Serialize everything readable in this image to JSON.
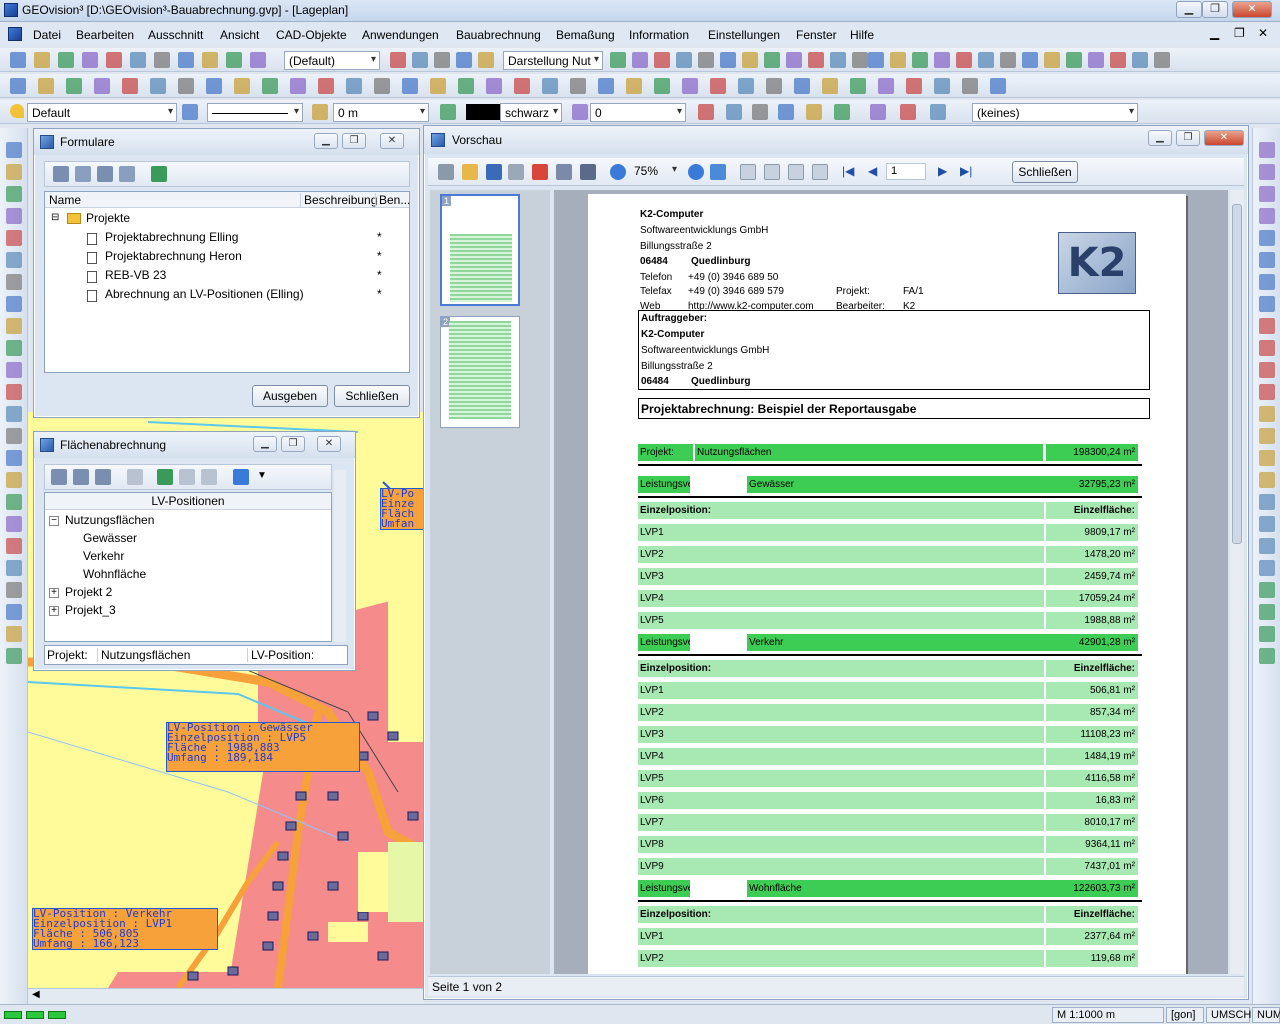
{
  "window": {
    "title": "GEOvision³  [D:\\GEOvision³-Bauabrechnung.gvp] - [Lageplan]"
  },
  "menu": [
    "Datei",
    "Bearbeiten",
    "Ausschnitt",
    "Ansicht",
    "CAD-Objekte",
    "Anwendungen",
    "Bauabrechnung",
    "Bemaßung",
    "Information",
    "Einstellungen",
    "Fenster",
    "Hilfe"
  ],
  "toolbar": {
    "style_combo": "(Default)",
    "display_combo": "Darstellung Nut",
    "layer_combo": "Default",
    "offset_value": "0 m",
    "color_name": "schwarz",
    "width_value": "0",
    "none_combo": "(keines)"
  },
  "formulare": {
    "title": "Formulare",
    "cols": [
      "Name",
      "Beschreibung",
      "Ben..."
    ],
    "root": "Projekte",
    "items": [
      {
        "name": "Projektabrechnung Elling",
        "mark": "*"
      },
      {
        "name": "Projektabrechnung Heron",
        "mark": "*"
      },
      {
        "name": "REB-VB 23",
        "mark": "*"
      },
      {
        "name": "Abrechnung an LV-Positionen (Elling)",
        "mark": "*"
      }
    ],
    "btn_output": "Ausgeben",
    "btn_close": "Schließen"
  },
  "flaechen": {
    "title": "Flächenabrechnung",
    "header": "LV-Positionen",
    "tree": [
      {
        "label": "Nutzungsflächen",
        "indent": 0,
        "exp": "−"
      },
      {
        "label": "Gewässer",
        "indent": 1,
        "exp": ""
      },
      {
        "label": "Verkehr",
        "indent": 1,
        "exp": ""
      },
      {
        "label": "Wohnfläche",
        "indent": 1,
        "exp": ""
      },
      {
        "label": "Projekt 2",
        "indent": 0,
        "exp": "+"
      },
      {
        "label": "Projekt_3",
        "indent": 0,
        "exp": "+"
      }
    ],
    "status_label1": "Projekt:",
    "status_value1": "Nutzungsflächen",
    "status_label2": "LV-Position:"
  },
  "map_labels": {
    "a": [
      "LV-Position   : Gewässer",
      "Einzelposition : LVP5",
      "Fläche        : 1988,883",
      "Umfang        : 189,184"
    ],
    "b": [
      "LV-Position   : Verkehr",
      "Einzelposition : LVP1",
      "Fläche        : 506,805",
      "Umfang        : 166,123"
    ],
    "c": [
      "LV-Po",
      "Einze",
      "Fläch",
      "Umfan"
    ]
  },
  "vorschau": {
    "title": "Vorschau",
    "zoom": "75%",
    "page_input": "1",
    "close_btn": "Schließen",
    "status": "Seite 1 von 2",
    "thumb1": "1",
    "thumb2": "2"
  },
  "report": {
    "company": [
      "K2-Computer",
      "Softwareentwicklungs GmbH",
      "Billungsstraße 2"
    ],
    "zip": "06484",
    "city": "Quedlinburg",
    "tel_label": "Telefon",
    "tel": "+49 (0) 3946 689 50",
    "fax_label": "Telefax",
    "fax": "+49 (0) 3946 689 579",
    "web_label": "Web",
    "web": "http://www.k2-computer.com",
    "proj_label": "Projekt:",
    "proj": "FA/1",
    "bearb_label": "Bearbeiter:",
    "bearb": "K2",
    "logo": "K2",
    "client_label": "Auftraggeber:",
    "client": [
      "K2-Computer",
      "Softwareentwicklungs GmbH",
      "Billungsstraße 2"
    ],
    "client_zip": "06484",
    "client_city": "Quedlinburg",
    "heading": "Projektabrechnung: Beispiel der Reportausgabe",
    "proj_row": {
      "label": "Projekt:",
      "name": "Nutzungsflächen",
      "value": "198300,24 m²"
    },
    "lv_label": "Leistungsverzeichnis:",
    "ep_label": "Einzelposition:",
    "ef_label": "Einzelfläche:",
    "groups": [
      {
        "name": "Gewässer",
        "value": "32795,23 m²",
        "items": [
          [
            "LVP1",
            "9809,17 m²"
          ],
          [
            "LVP2",
            "1478,20 m²"
          ],
          [
            "LVP3",
            "2459,74 m²"
          ],
          [
            "LVP4",
            "17059,24 m²"
          ],
          [
            "LVP5",
            "1988,88 m²"
          ]
        ]
      },
      {
        "name": "Verkehr",
        "value": "42901,28 m²",
        "items": [
          [
            "LVP1",
            "506,81 m²"
          ],
          [
            "LVP2",
            "857,34 m²"
          ],
          [
            "LVP3",
            "11108,23 m²"
          ],
          [
            "LVP4",
            "1484,19 m²"
          ],
          [
            "LVP5",
            "4116,58 m²"
          ],
          [
            "LVP6",
            "16,83 m²"
          ],
          [
            "LVP7",
            "8010,17 m²"
          ],
          [
            "LVP8",
            "9364,11 m²"
          ],
          [
            "LVP9",
            "7437,01 m²"
          ]
        ]
      },
      {
        "name": "Wohnfläche",
        "value": "122603,73 m²",
        "items": [
          [
            "LVP1",
            "2377,64 m²"
          ],
          [
            "LVP2",
            "119,68 m²"
          ]
        ]
      }
    ]
  },
  "statusbar": {
    "scale": "M 1:1000  m",
    "unit": "[gon]",
    "umsch": "UMSCH",
    "num": "NUM"
  },
  "colors": {
    "dark_green": "#3dcc54",
    "light_green": "#a8e8b2",
    "map_yellow": "#fffb9a",
    "map_pink": "#f58b8b",
    "map_orange": "#f6a13a"
  }
}
